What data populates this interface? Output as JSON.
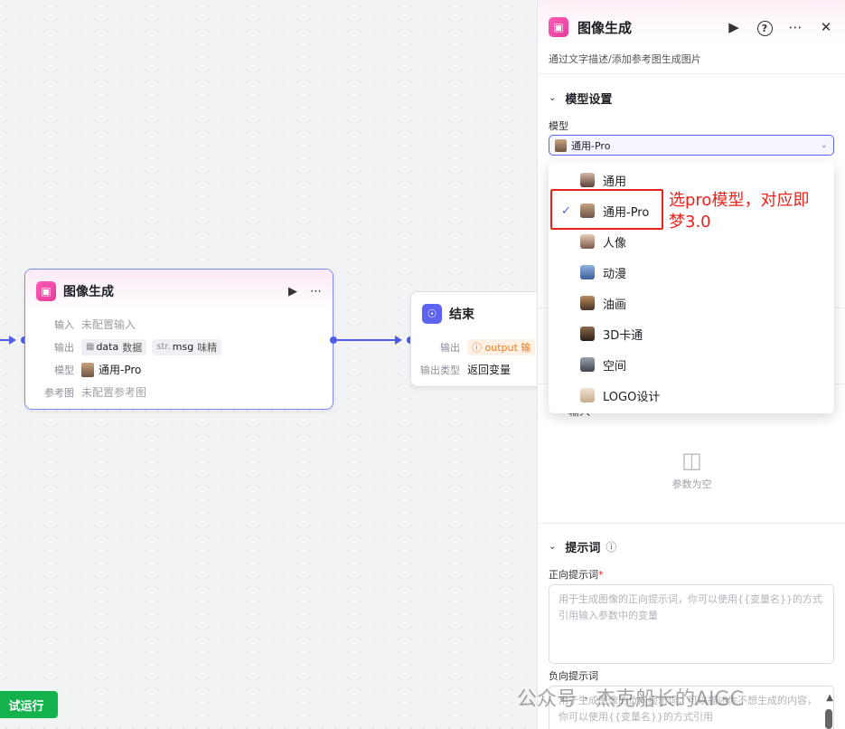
{
  "canvas": {
    "image_node": {
      "title": "图像生成",
      "rows": {
        "input_label": "输入",
        "input_value": "未配置输入",
        "output_label": "输出",
        "output_chip1_name": "data",
        "output_chip1_desc": "数据",
        "output_chip2_type": "str.",
        "output_chip2_name": "msg",
        "output_chip2_desc": "味精",
        "model_label": "模型",
        "model_value": "通用-Pro",
        "ref_label": "参考图",
        "ref_value": "未配置参考图"
      }
    },
    "end_node": {
      "title": "结束",
      "output_label": "输出",
      "output_chip": "output 输",
      "output_type_label": "输出类型",
      "output_type_value": "返回变量"
    },
    "run_button": "试运行"
  },
  "panel": {
    "title": "图像生成",
    "description": "通过文字描述/添加参考图生成图片",
    "model_section": "模型设置",
    "model_label": "模型",
    "selected_model": "通用-Pro",
    "options": [
      "通用",
      "通用-Pro",
      "人像",
      "动漫",
      "油画",
      "3D卡通",
      "空间",
      "LOGO设计"
    ],
    "selected_index": 1,
    "annotation": "选pro模型，对应即梦3.0",
    "input_section_partial": "输入",
    "empty_params": "参数为空",
    "prompt_section": "提示词",
    "positive_label": "正向提示词",
    "required_mark": "*",
    "positive_placeholder": "用于生成图像的正向提示词，你可以使用{{变量名}}的方式引用输入参数中的变量",
    "negative_label": "负向提示词",
    "negative_placeholder": "用于生成图像的负向提示词，可以描述你不想生成的内容，你可以使用{{变量名}}的方式引用"
  },
  "watermark": "公众号 · 杰克船长的AIGC"
}
